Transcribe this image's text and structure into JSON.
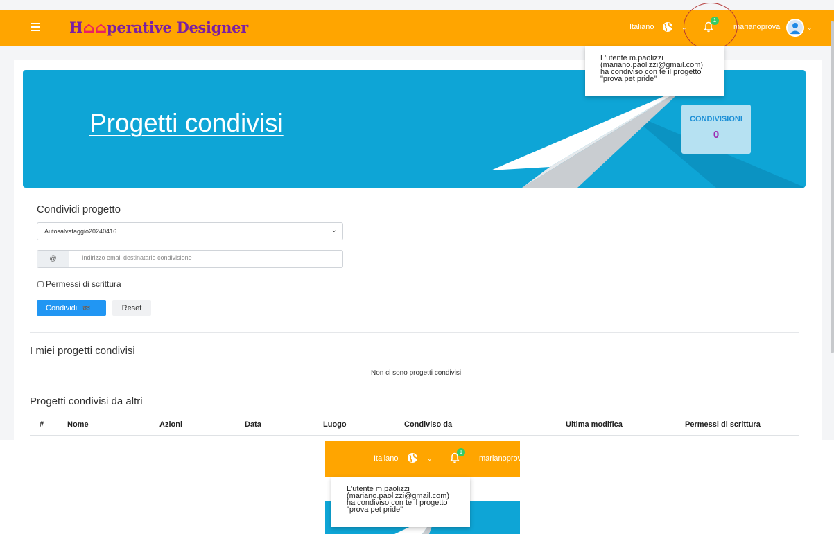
{
  "header": {
    "brand_part1": "H",
    "brand_part2": "perative Designer",
    "language": "Italiano",
    "notification_count": "1",
    "username": "marianoprova",
    "menu_icon": "hamburger-menu-icon",
    "globe_icon": "globe-icon",
    "bell_icon": "bell-icon",
    "avatar_icon": "user-avatar-icon",
    "accent_color": "#ffa500"
  },
  "notification": {
    "line1": "L'utente m.paolizzi",
    "line2": "(mariano.paolizzi@gmail.com)",
    "line3": "ha condiviso con te il progetto",
    "line4": "\"prova pet pride\""
  },
  "hero": {
    "title": "Progetti condivisi",
    "counter_label": "CONDIVISIONI",
    "counter_value": "0"
  },
  "share_form": {
    "section_title": "Condividi progetto",
    "selected_project": "Autosalvataggio20240416",
    "email_prefix": "@",
    "email_placeholder": "Indirizzo email destinatario condivisione",
    "write_permission_label": "Permessi di scrittura",
    "share_button": "Condividi",
    "reset_button": "Reset"
  },
  "my_shared": {
    "title": "I miei progetti condivisi",
    "empty_message": "Non ci sono progetti condivisi"
  },
  "shared_by_others": {
    "title": "Progetti condivisi da altri",
    "columns": [
      "#",
      "Nome",
      "Azioni",
      "Data",
      "Luogo",
      "Condiviso da",
      "Ultima modifica",
      "Permessi di scrittura"
    ]
  },
  "zoom_inset": {
    "language": "Italiano",
    "notification_count": "1",
    "username": "marianoprova"
  }
}
